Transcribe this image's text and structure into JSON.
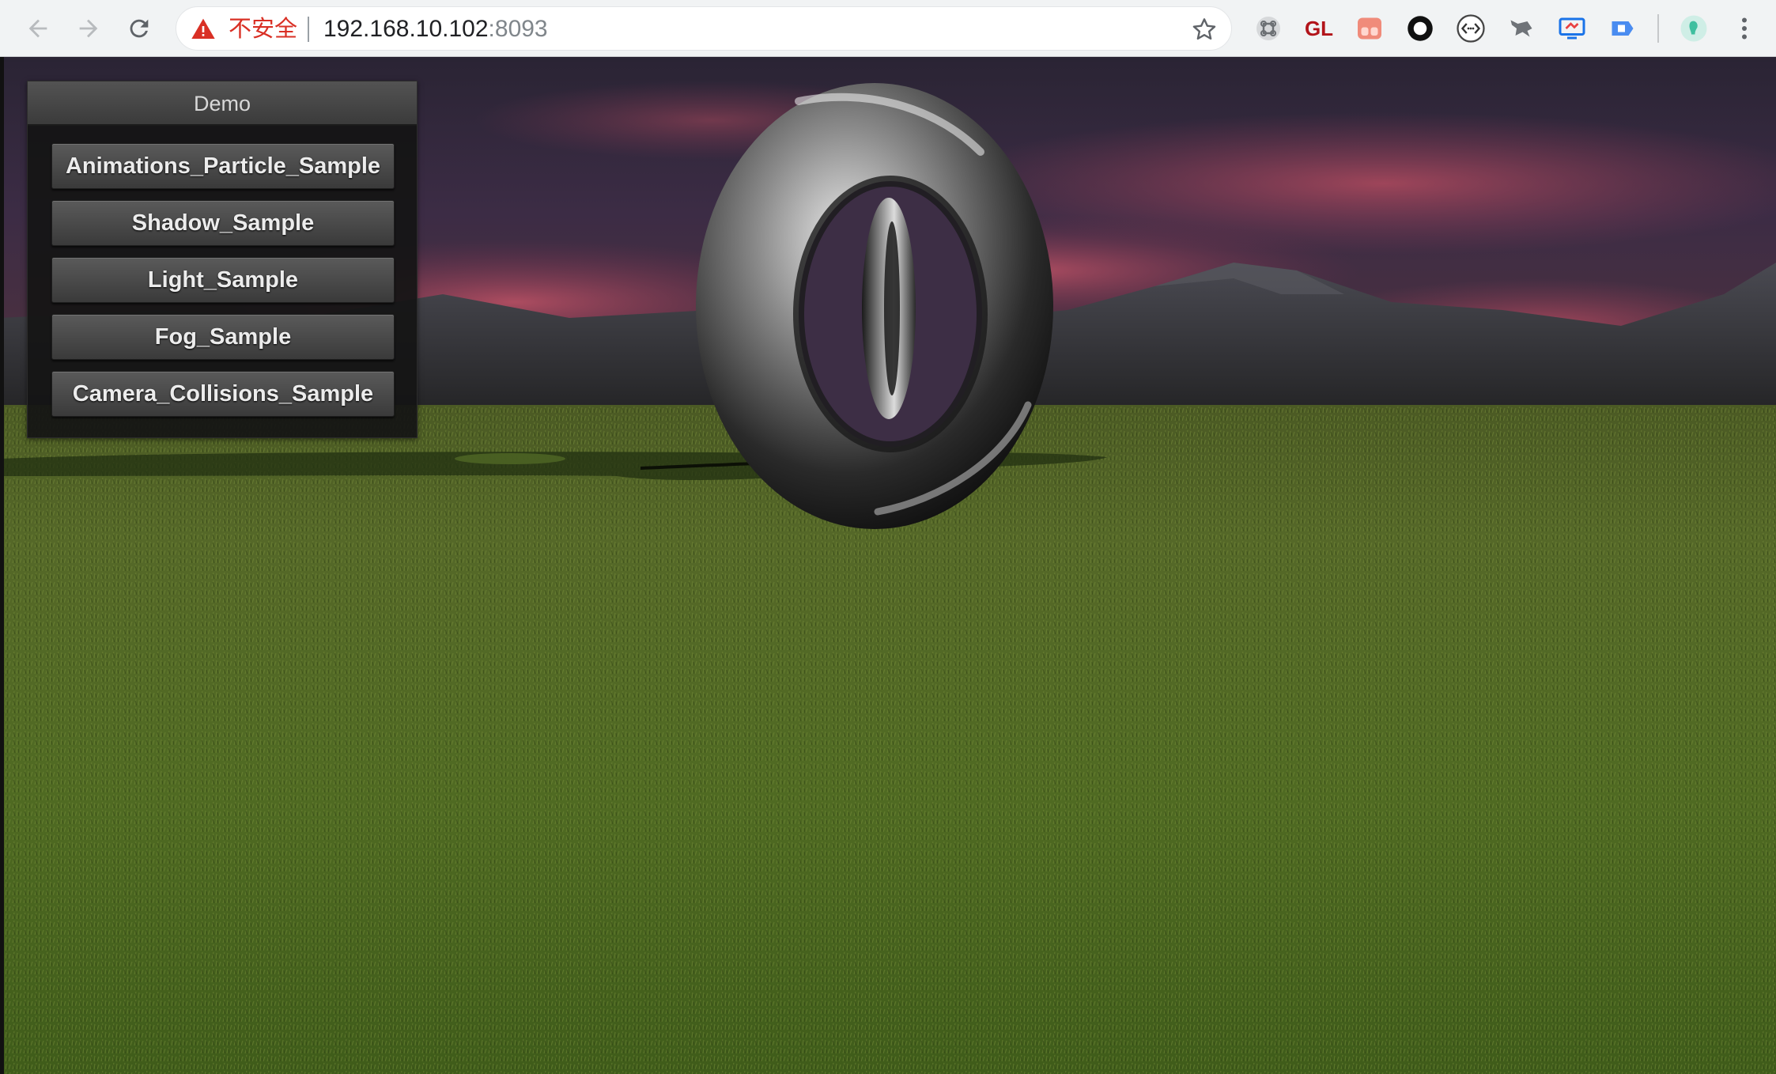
{
  "browser": {
    "security_label": "不安全",
    "url_host": "192.168.10.102",
    "url_port": ":8093",
    "extensions": [
      "extension-icon",
      "gl-icon",
      "red-extension-icon",
      "ring-icon",
      "code-icon",
      "fox-icon",
      "monitor-icon",
      "blue-extension-icon",
      "profile-icon"
    ],
    "gl_label": "GL",
    "accent_warning": "#d93025"
  },
  "demo_panel": {
    "title": "Demo",
    "buttons": [
      "Animations_Particle_Sample",
      "Shadow_Sample",
      "Light_Sample",
      "Fog_Sample",
      "Camera_Collisions_Sample"
    ]
  },
  "scene": {
    "objects": [
      "torus-outer",
      "torus-inner",
      "ground-plane",
      "skybox",
      "mountains",
      "shadow"
    ]
  }
}
